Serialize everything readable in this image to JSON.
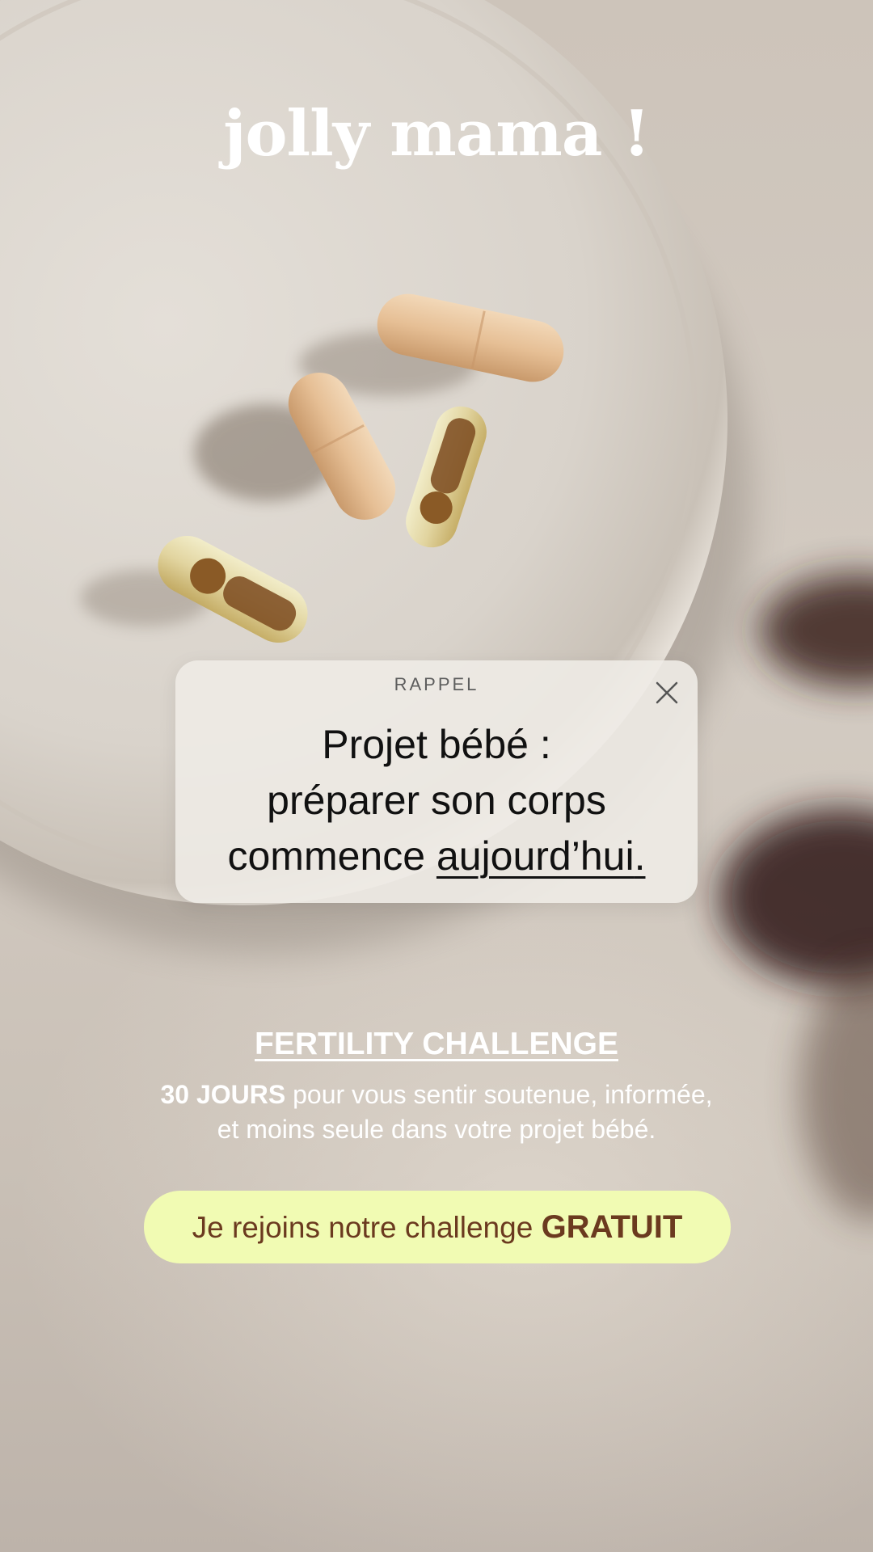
{
  "brand": {
    "logo_text": "jolly mama !"
  },
  "reminder": {
    "label": "RAPPEL",
    "heading_line1": "Projet bébé :",
    "heading_line2": "préparer son corps",
    "heading_line3_start": "commence",
    "heading_line3_underlined": "aujourd’hui",
    "heading_line3_end": ".",
    "close_icon": "close-icon"
  },
  "challenge": {
    "title": "FERTILITY CHALLENGE",
    "desc_strong": "30 JOURS",
    "desc_line1_rest": "pour vous sentir soutenue, informée,",
    "desc_line2": "et moins seule dans votre projet bébé."
  },
  "cta": {
    "label_start": "Je rejoins notre challenge",
    "label_strong": "GRATUIT"
  },
  "colors": {
    "cta_background": "#f1fbb3",
    "cta_text": "#6b3a1f",
    "card_background": "#eeebe6",
    "text_light": "#ffffff"
  }
}
